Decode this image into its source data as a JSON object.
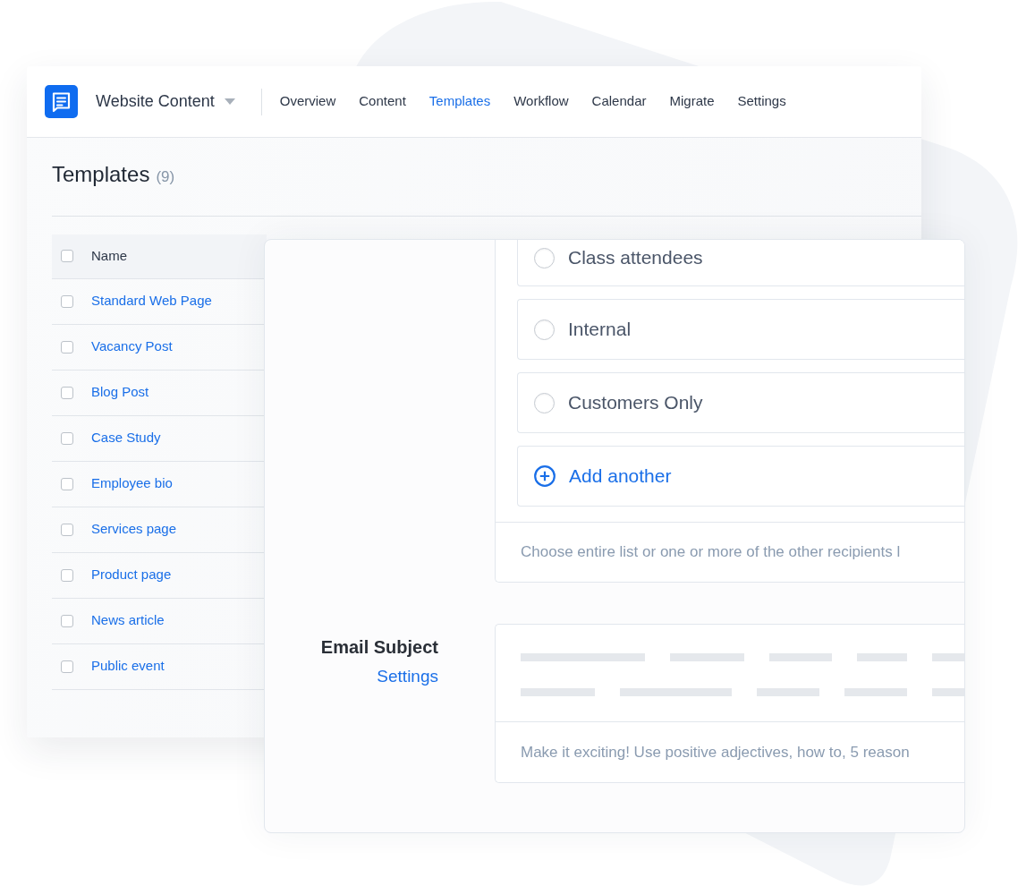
{
  "header": {
    "workspace": "Website Content",
    "nav": [
      {
        "label": "Overview",
        "selected": false
      },
      {
        "label": "Content",
        "selected": false
      },
      {
        "label": "Templates",
        "selected": true
      },
      {
        "label": "Workflow",
        "selected": false
      },
      {
        "label": "Calendar",
        "selected": false
      },
      {
        "label": "Migrate",
        "selected": false
      },
      {
        "label": "Settings",
        "selected": false
      }
    ]
  },
  "page": {
    "title": "Templates",
    "count": "(9)"
  },
  "table": {
    "columns": [
      "Name"
    ],
    "select_all_checked": false,
    "rows": [
      {
        "name": "Standard Web Page",
        "checked": false
      },
      {
        "name": "Vacancy Post",
        "checked": false
      },
      {
        "name": "Blog Post",
        "checked": false
      },
      {
        "name": "Case Study",
        "checked": false
      },
      {
        "name": "Employee bio",
        "checked": false
      },
      {
        "name": "Services page",
        "checked": false
      },
      {
        "name": "Product page",
        "checked": false
      },
      {
        "name": "News article",
        "checked": false
      },
      {
        "name": "Public event",
        "checked": false
      }
    ]
  },
  "recipients": {
    "options": [
      {
        "label": "Class attendees",
        "selected": false
      },
      {
        "label": "Internal",
        "selected": false
      },
      {
        "label": "Customers Only",
        "selected": false
      }
    ],
    "add_label": "Add another",
    "help": "Choose entire list or one or more of the other recipients l"
  },
  "email_subject": {
    "label": "Email Subject",
    "link": "Settings",
    "help": "Make it exciting! Use positive adjectives, how to, 5 reason"
  }
}
